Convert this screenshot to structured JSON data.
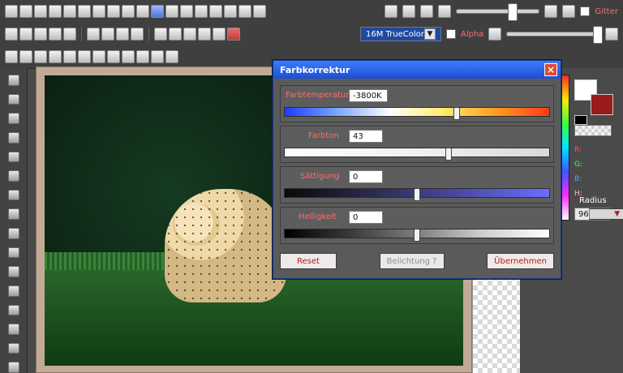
{
  "toolbar": {
    "right_gitter_label": "Gitter",
    "color_mode_select": "16M TrueColor",
    "alpha_label": "Alpha"
  },
  "right_panel": {
    "radius_label": "Radius",
    "radius_value": "96",
    "rgb_labels": [
      "R:",
      "G:",
      "B:",
      "H:"
    ]
  },
  "dialog": {
    "title": "Farbkorrektur",
    "sections": [
      {
        "label": "Farbtemperatur",
        "value": "-3800K",
        "position": 0.65
      },
      {
        "label": "Farbton",
        "value": "43",
        "position": 0.62
      },
      {
        "label": "Sättigung",
        "value": "0",
        "position": 0.5
      },
      {
        "label": "Helligkeit",
        "value": "0",
        "position": 0.5
      }
    ],
    "buttons": {
      "reset": "Reset",
      "belichtung": "Belichtung ?",
      "uebernehmen": "Übernehmen"
    }
  },
  "colors": {
    "dialog_title_bar": "#1d4fd0",
    "accent_red_text": "#ff6c6c"
  }
}
